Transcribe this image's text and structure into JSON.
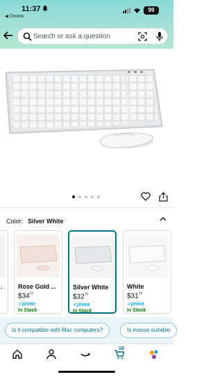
{
  "status_bar": {
    "time": "11:37",
    "back_app": "◀ Chrome",
    "battery": "99"
  },
  "search": {
    "placeholder": "Search or ask a question"
  },
  "color": {
    "label": "Color:",
    "value": "Silver White"
  },
  "variants": [
    {
      "name": "Rose Gold ...",
      "price_whole": "$34",
      "price_cents": "77",
      "prime": "✓prime",
      "stock": "In Stock"
    },
    {
      "name": "Silver White",
      "price_whole": "$32",
      "price_cents": "77",
      "prime": "✓prime",
      "stock": "In Stock"
    },
    {
      "name": "White",
      "price_whole": "$31",
      "price_cents": "77",
      "prime": "✓prime",
      "stock": "In Stock"
    }
  ],
  "first_card_name": ".",
  "suggestions": [
    "Is it compatible with Mac computers?",
    "Is mouse suitable"
  ],
  "tabbar": {
    "cart_count": "18"
  },
  "colors": {
    "accent": "#007185",
    "prime": "#00a8e1",
    "stock": "#007600"
  }
}
